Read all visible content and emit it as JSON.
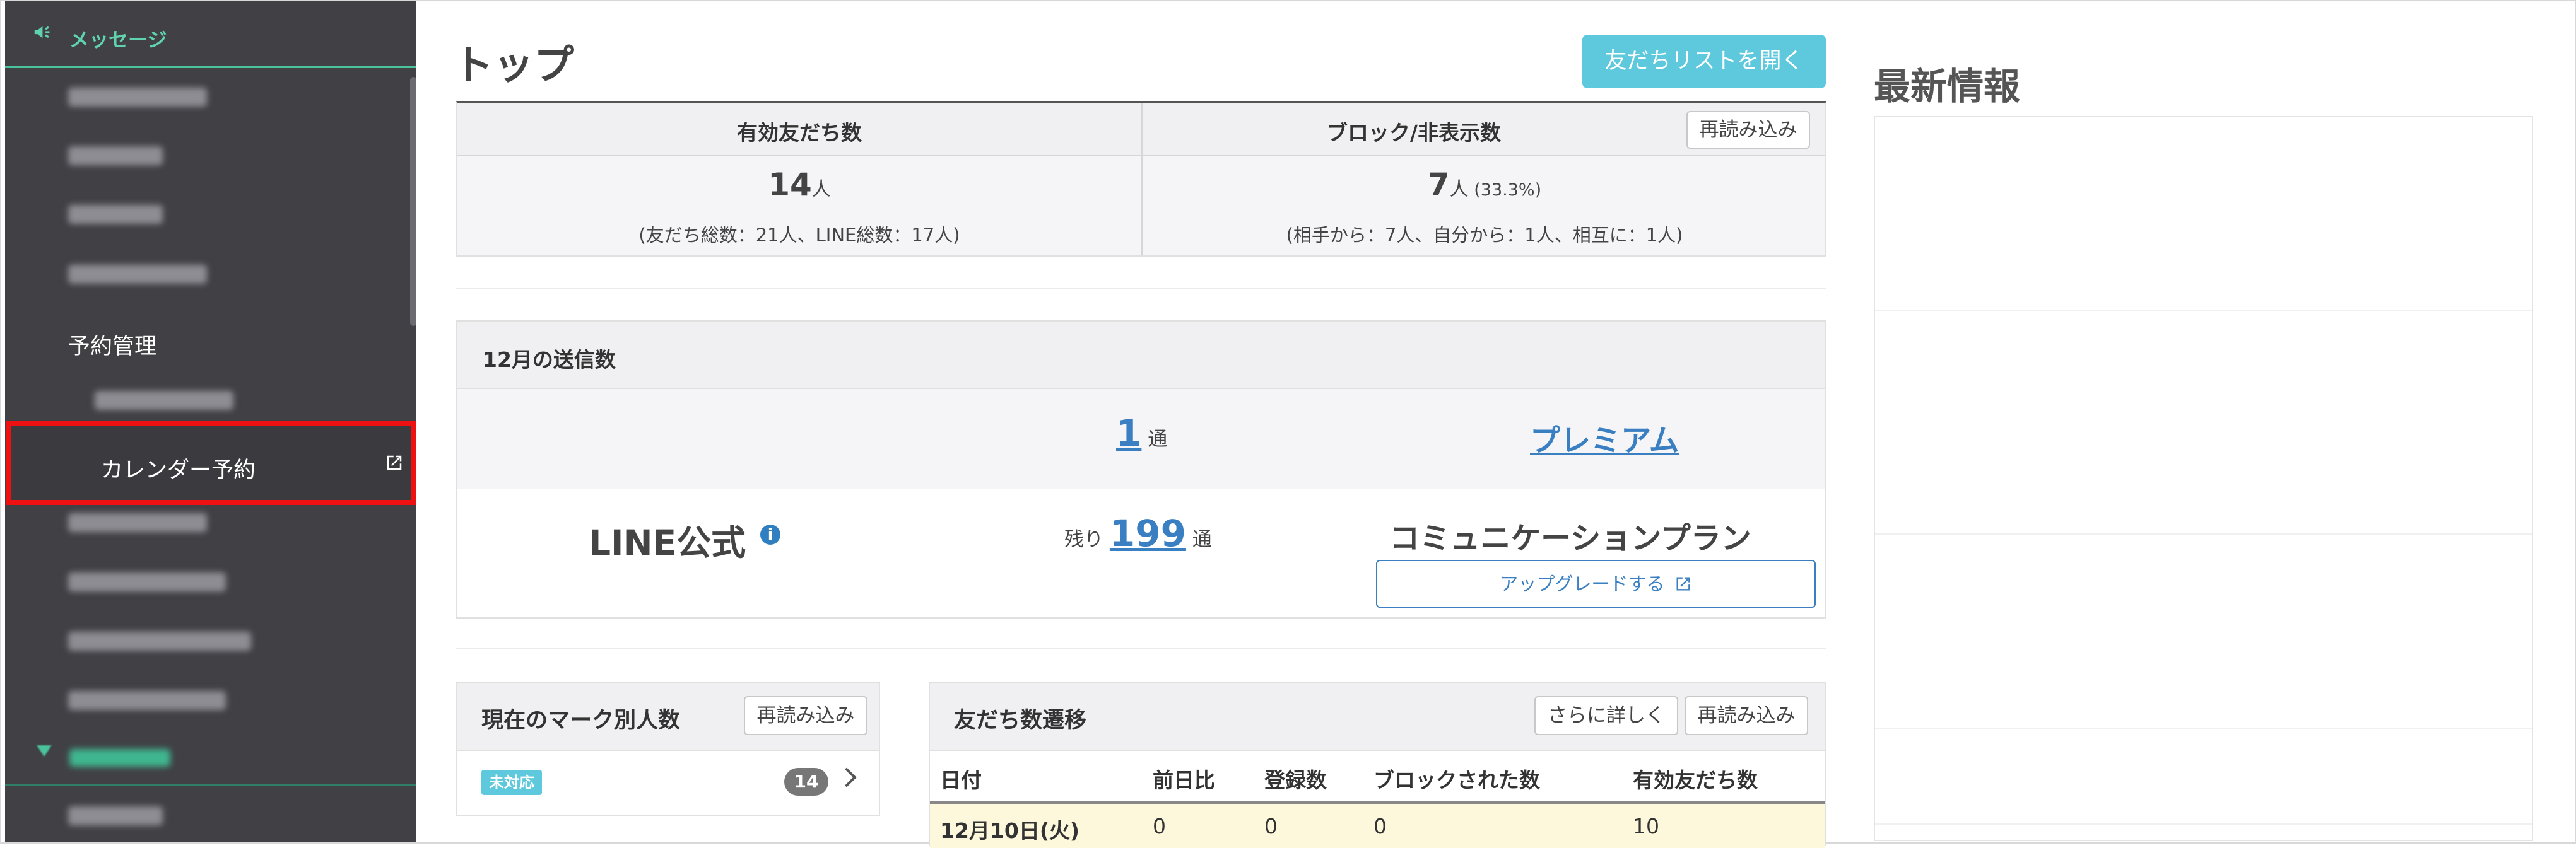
{
  "sidebar": {
    "header": {
      "label": "メッセージ",
      "icon": "megaphone-icon"
    },
    "items": [
      {
        "label": "予約管理"
      },
      {
        "label": "カレンダー予約",
        "icon": "external-link-icon"
      }
    ],
    "colors": {
      "background": "#414145",
      "accent": "#49c39a",
      "highlight": "#ee1111"
    }
  },
  "main": {
    "title": "トップ",
    "friend_list_button": "友だちリストを開く",
    "stats": {
      "valid_friends_label": "有効友だち数",
      "valid_friends_value": "14",
      "valid_friends_unit": "人",
      "valid_friends_sub": "(友だち総数：21人、LINE総数：17人)",
      "blocked_label": "ブロック/非表示数",
      "blocked_value": "7",
      "blocked_unit": "人",
      "blocked_pct": "(33.3%)",
      "blocked_sub": "(相手から：7人、自分から：1人、相互に：1人)",
      "reload_button": "再読み込み"
    },
    "send_count": {
      "title": "12月の送信数",
      "sent_value": "1",
      "sent_unit": "通",
      "plan_link": "プレミアム",
      "line_label": "LINE公式",
      "remaining_prefix": "残り",
      "remaining_value": "199",
      "remaining_unit": "通",
      "plan_name": "コミュニケーションプラン",
      "upgrade_button": "アップグレードする"
    },
    "marks": {
      "title": "現在のマーク別人数",
      "reload_button": "再読み込み",
      "badge": "未対応",
      "count": "14"
    },
    "transition": {
      "title": "友だち数遷移",
      "more_button": "さらに詳しく",
      "reload_button": "再読み込み",
      "columns": [
        "日付",
        "前日比",
        "登録数",
        "ブロックされた数",
        "有効友だち数"
      ],
      "rows": [
        [
          "12月10日(火)",
          "0",
          "0",
          "0",
          "10"
        ]
      ]
    }
  },
  "news": {
    "title": "最新情報"
  }
}
